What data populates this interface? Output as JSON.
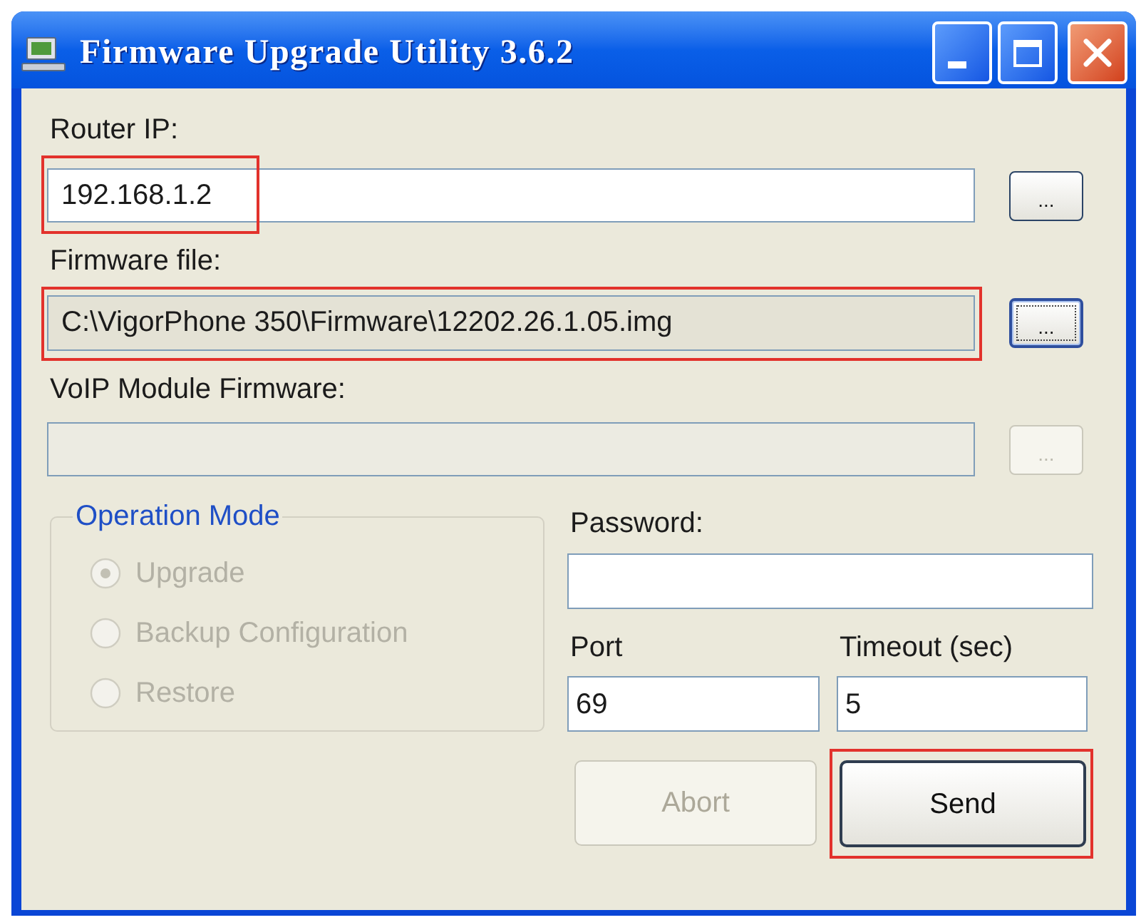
{
  "window": {
    "title": "Firmware Upgrade Utility 3.6.2"
  },
  "file_fields": [
    {
      "label": "Router IP:",
      "value": "192.168.1.2",
      "readonly": false,
      "disabled": false,
      "value_highlighted": true,
      "field_highlighted": false,
      "browse_button": {
        "label": "...",
        "focused": false,
        "disabled": false
      }
    },
    {
      "label": "Firmware file:",
      "value": "C:\\VigorPhone 350\\Firmware\\12202.26.1.05.img",
      "readonly": true,
      "disabled": false,
      "value_highlighted": false,
      "field_highlighted": true,
      "browse_button": {
        "label": "...",
        "focused": true,
        "disabled": false
      }
    },
    {
      "label": "VoIP Module Firmware:",
      "readonly": false,
      "disabled": true,
      "value_highlighted": false,
      "field_highlighted": false,
      "browse_button": {
        "label": "...",
        "focused": false,
        "disabled": true
      }
    }
  ],
  "operation_mode": {
    "title": "Operation Mode",
    "disabled": true,
    "options": [
      {
        "label": "Upgrade",
        "selected": true
      },
      {
        "label": "Backup Configuration",
        "selected": false
      },
      {
        "label": "Restore",
        "selected": false
      }
    ]
  },
  "password": {
    "label": "Password:"
  },
  "port": {
    "label": "Port",
    "value": "69"
  },
  "timeout": {
    "label": "Timeout (sec)",
    "value": "5"
  },
  "buttons": [
    {
      "label": "Abort",
      "disabled": true,
      "default": false,
      "highlighted": false
    },
    {
      "label": "Send",
      "disabled": false,
      "default": true,
      "highlighted": true
    }
  ]
}
